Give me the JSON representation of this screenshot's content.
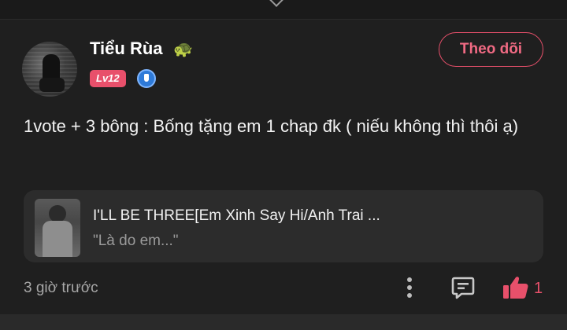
{
  "post": {
    "author": {
      "name": "Tiểu Rùa",
      "emoji": "🐢",
      "level": "Lv12"
    },
    "follow_label": "Theo dõi",
    "content": "1vote + 3 bông : Bống tặng em 1 chap đk ( niếu không thì thôi ạ)",
    "linked_story": {
      "title": "I'LL BE THREE[Em Xinh Say Hi/Anh Trai ...",
      "excerpt": "\"Là do em...\""
    },
    "timestamp": "3 giờ trước",
    "likes": "1"
  },
  "colors": {
    "accent": "#e8506b",
    "background": "#1f1f1f",
    "card": "#2c2c2c"
  }
}
